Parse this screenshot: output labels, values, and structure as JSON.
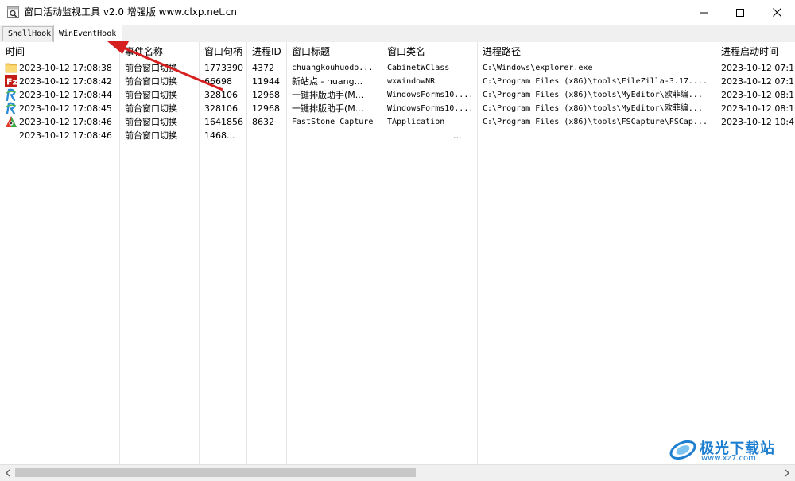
{
  "window": {
    "title": "窗口活动监视工具 v2.0 增强版 www.clxp.net.cn"
  },
  "tabs": [
    {
      "label": "ShellHook",
      "active": false
    },
    {
      "label": "WinEventHook",
      "active": true
    }
  ],
  "columns": [
    "时间",
    "事件名称",
    "窗口句柄",
    "进程ID",
    "窗口标题",
    "窗口类名",
    "进程路径",
    "进程启动时间"
  ],
  "rows": [
    {
      "icon": "folder-icon",
      "time": "2023-10-12 17:08:38",
      "event": "前台窗口切换",
      "hwnd": "1773390",
      "pid": "4372",
      "title": "chuangkouhuodo...",
      "class": "CabinetWClass",
      "path": "C:\\Windows\\explorer.exe",
      "start": "2023-10-12 07:1"
    },
    {
      "icon": "filezilla-icon",
      "time": "2023-10-12 17:08:42",
      "event": "前台窗口切换",
      "hwnd": "66698",
      "pid": "11944",
      "title": "新站点 - huang...",
      "class": "wxWindowNR",
      "path": "C:\\Program Files (x86)\\tools\\FileZilla-3.17....",
      "start": "2023-10-12 07:1"
    },
    {
      "icon": "myeditor-icon",
      "time": "2023-10-12 17:08:44",
      "event": "前台窗口切换",
      "hwnd": "328106",
      "pid": "12968",
      "title": "一键排版助手(M...",
      "class": "WindowsForms10....",
      "path": "C:\\Program Files (x86)\\tools\\MyEditor\\欧菲编...",
      "start": "2023-10-12 08:1"
    },
    {
      "icon": "myeditor-icon",
      "time": "2023-10-12 17:08:45",
      "event": "前台窗口切换",
      "hwnd": "328106",
      "pid": "12968",
      "title": "一键排版助手(M...",
      "class": "WindowsForms10....",
      "path": "C:\\Program Files (x86)\\tools\\MyEditor\\欧菲编...",
      "start": "2023-10-12 08:1"
    },
    {
      "icon": "fscapture-icon",
      "time": "2023-10-12 17:08:46",
      "event": "前台窗口切换",
      "hwnd": "1641856",
      "pid": "8632",
      "title": "FastStone Capture",
      "class": "TApplication",
      "path": "C:\\Program Files (x86)\\tools\\FSCapture\\FSCap...",
      "start": "2023-10-12 10:4"
    },
    {
      "icon": "",
      "time": "2023-10-12 17:08:46",
      "event": "前台窗口切换",
      "hwnd": "1468...",
      "pid": "",
      "title": "",
      "class": "...",
      "path": "",
      "start": ""
    }
  ],
  "watermark": {
    "title": "极光下载站",
    "url": "www.xz7.com"
  },
  "colors": {
    "accent_arrow": "#d62020",
    "watermark": "#1e7fd0"
  }
}
